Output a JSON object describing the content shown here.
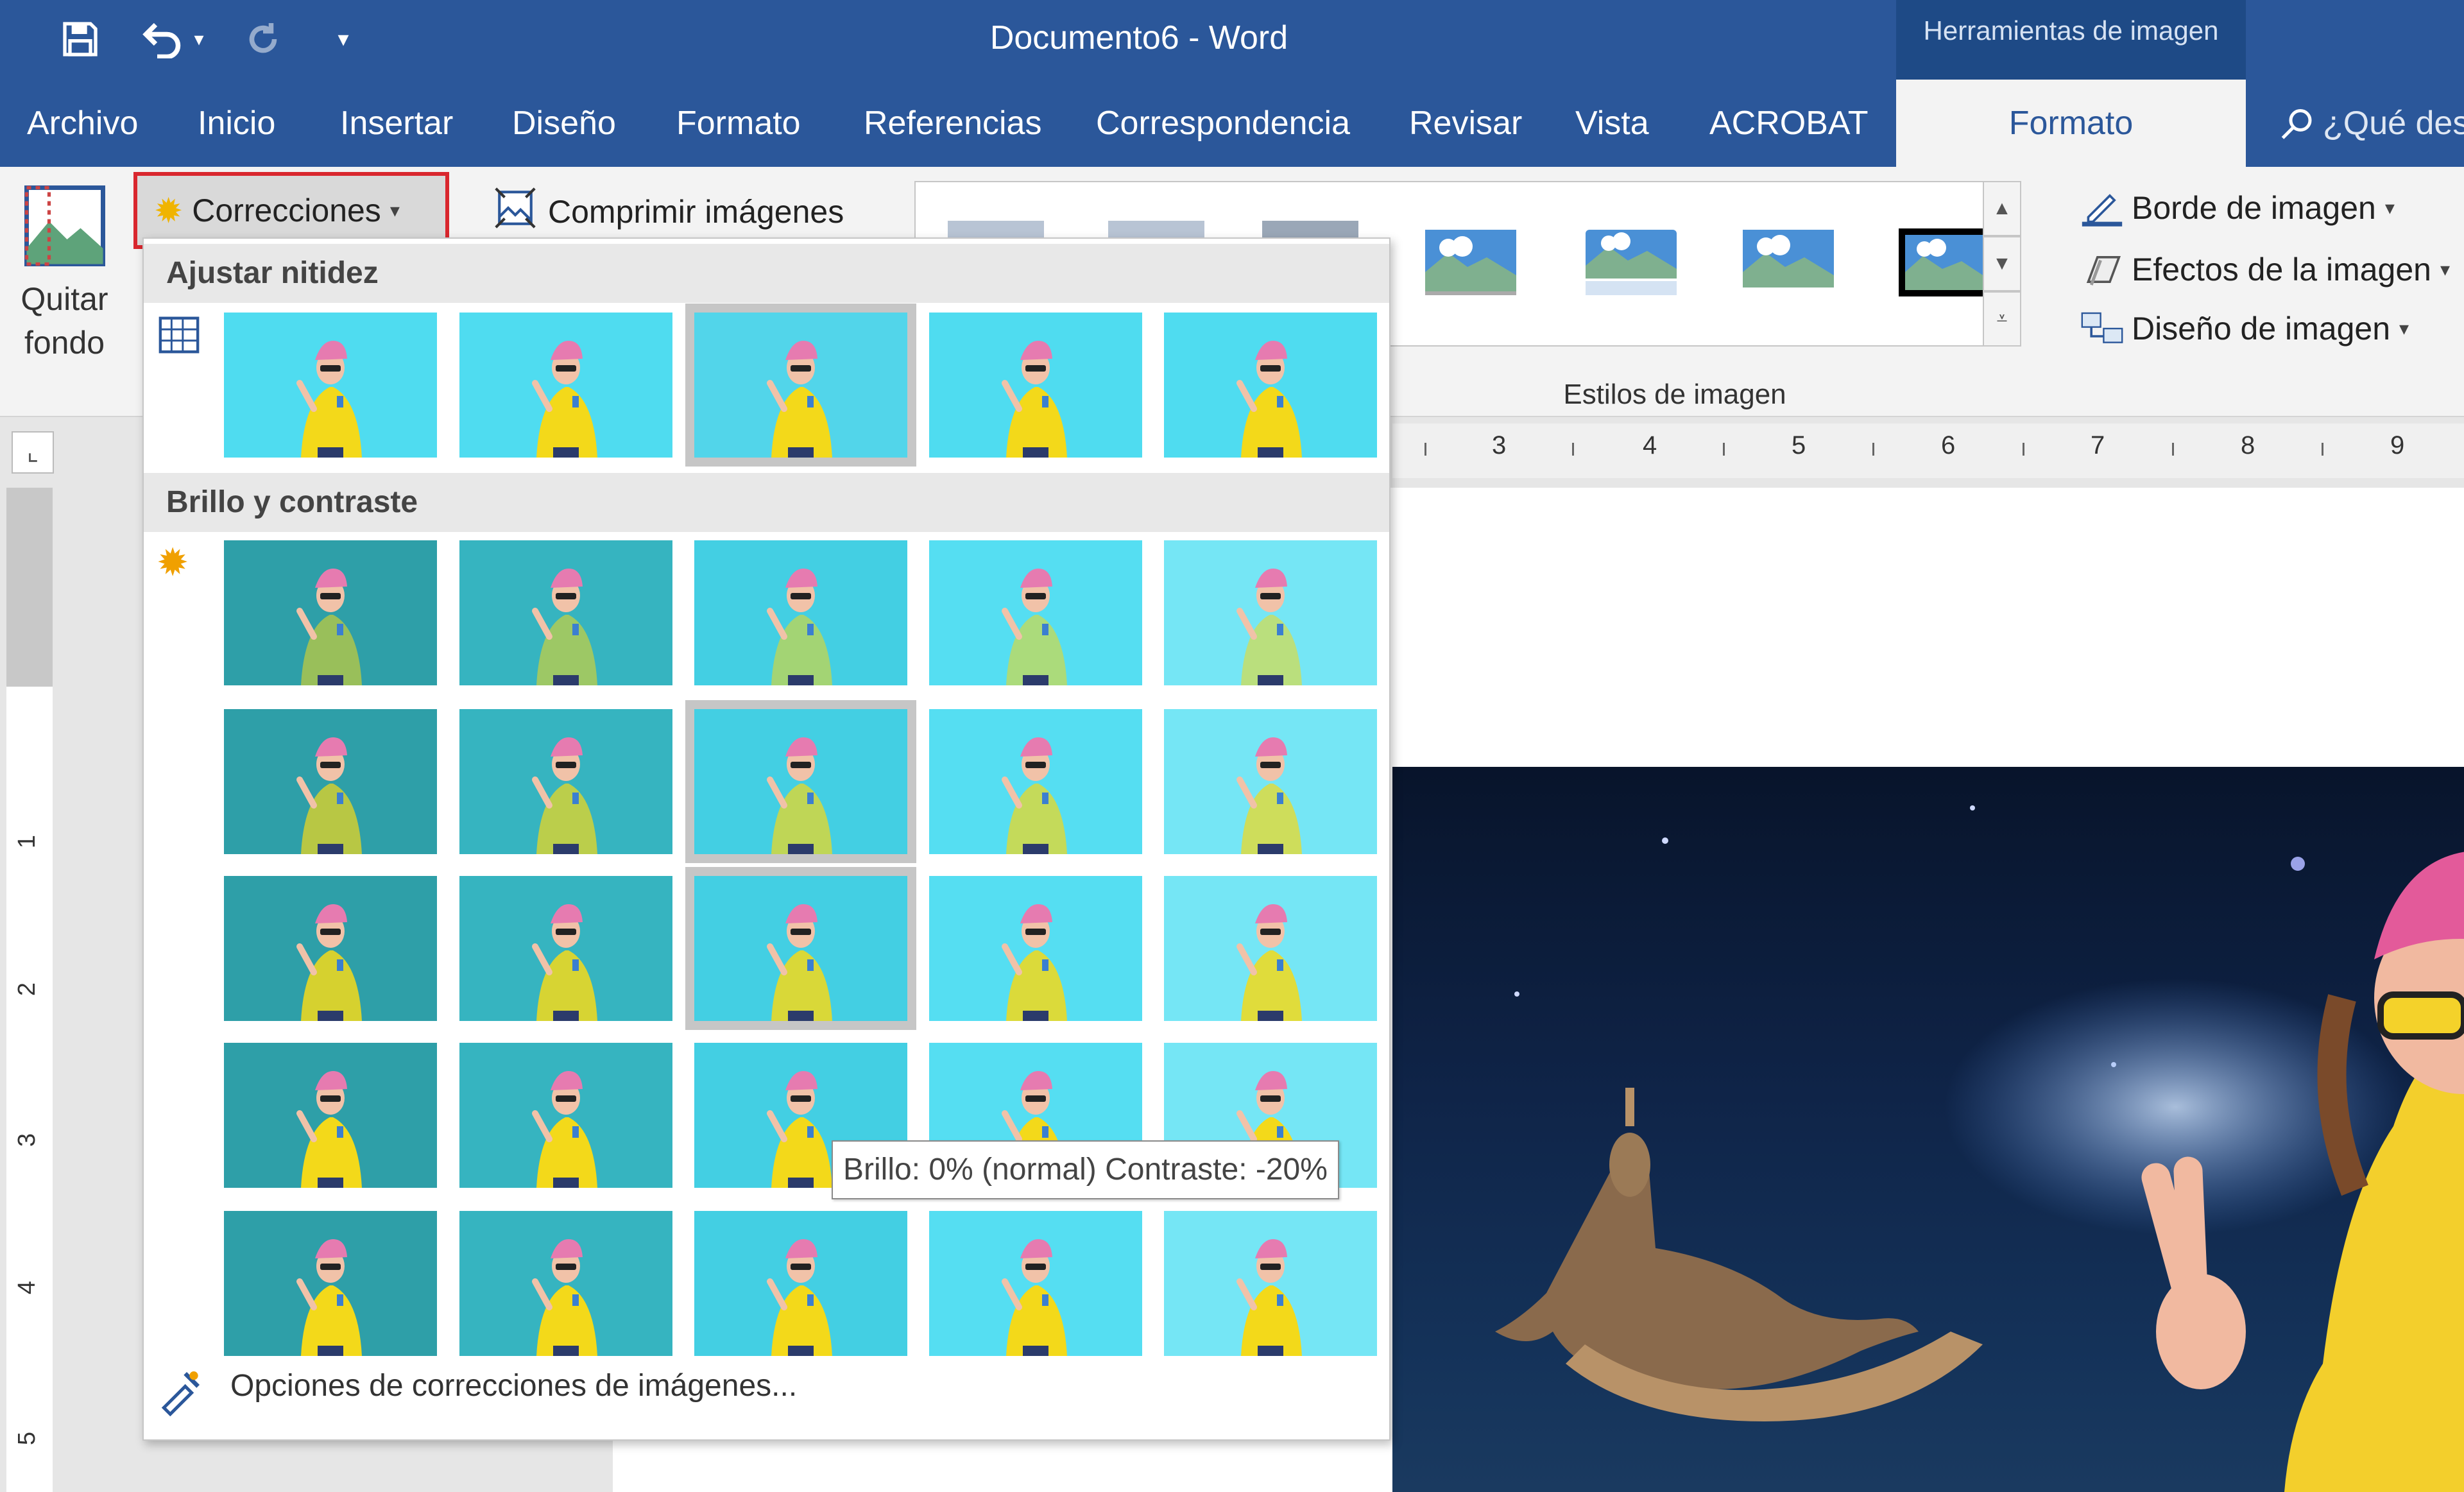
{
  "title_bar": {
    "document_title": "Documento6  -  Word",
    "context_group": "Herramientas de imagen",
    "qat": [
      {
        "name": "save-icon",
        "glyph": "💾"
      },
      {
        "name": "undo-icon",
        "glyph": "↶"
      },
      {
        "name": "redo-icon",
        "glyph": "↻"
      },
      {
        "name": "customize-qat-icon",
        "glyph": "▾"
      }
    ]
  },
  "tabs": [
    "Archivo",
    "Inicio",
    "Insertar",
    "Diseño",
    "Formato",
    "Referencias",
    "Correspondencia",
    "Revisar",
    "Vista",
    "ACROBAT"
  ],
  "active_tab": "Formato",
  "tell_me": "¿Qué desea hacer?",
  "ribbon": {
    "remove_bg_line1": "Quitar",
    "remove_bg_line2": "fondo",
    "corrections": "Correcciones",
    "compress": "Comprimir imágenes",
    "picture_styles_group": "Estilos de imagen",
    "picture_border": "Borde de imagen",
    "picture_effects": "Efectos de la imagen",
    "picture_layout": "Diseño de imagen"
  },
  "ruler": {
    "horizontal": [
      "3",
      "4",
      "5",
      "6",
      "7",
      "8",
      "9"
    ],
    "vertical": [
      "1",
      "1",
      "2",
      "3",
      "4",
      "5"
    ]
  },
  "dropdown": {
    "sharpen_header": "Ajustar nitidez",
    "brightness_header": "Brillo y contraste",
    "more_options": "Opciones de correcciones de imágenes...",
    "tooltip": "Brillo: 0% (normal) Contraste: -20%"
  },
  "colors": {
    "word_blue": "#2b579a",
    "context_blue": "#1e4a86",
    "highlight_red": "#d9272e",
    "thumb_cyan": "#3fd5ee"
  }
}
